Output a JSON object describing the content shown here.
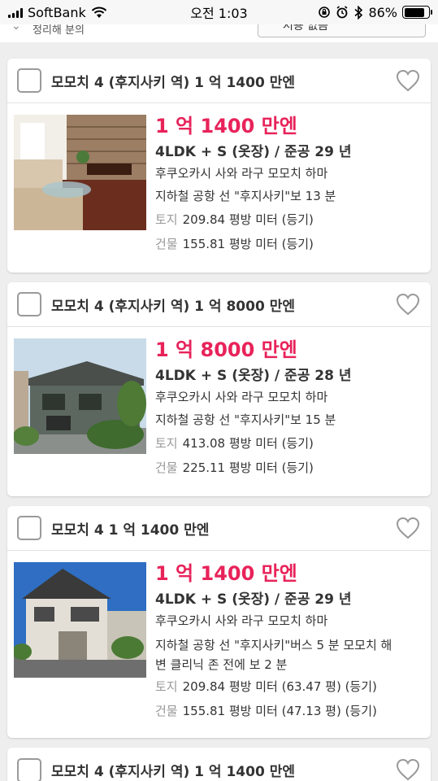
{
  "status_bar": {
    "carrier": "SoftBank",
    "time": "오전 1:03",
    "battery": "86%",
    "battery_level": 0.86
  },
  "top_strip": {
    "sort_hint": "정리해 분의",
    "sort_value": "저용 없음"
  },
  "listings": [
    {
      "title": "모모치 4 (후지사키 역) 1 억 1400 만엔",
      "price": "1 억 1400 만엔",
      "spec": "4LDK + S (옷장)  /  준공 29 년",
      "address": "후쿠오카시 사와 라구 모모치 하마",
      "access": [
        "지하철 공항 선 \"후지사키\"보 13 분"
      ],
      "land_label": "토지",
      "land": "209.84 평방 미터 (등기)",
      "building_label": "건물",
      "building": "155.81 평방 미터 (등기)"
    },
    {
      "title": "모모치 4 (후지사키 역) 1 억 8000 만엔",
      "price": "1 억 8000 만엔",
      "spec": "4LDK + S (옷장)  /  준공 28 년",
      "address": "후쿠오카시 사와 라구 모모치 하마",
      "access": [
        "지하철 공항 선 \"후지사키\"보 15 분"
      ],
      "land_label": "토지",
      "land": "413.08 평방 미터 (등기)",
      "building_label": "건물",
      "building": "225.11 평방 미터 (등기)"
    },
    {
      "title": "모모치 4 1 억 1400 만엔",
      "price": "1 억 1400 만엔",
      "spec": "4LDK + S (옷장)  /  준공 29 년",
      "address": "후쿠오카시 사와 라구 모모치 하마",
      "access": [
        "지하철 공항 선 \"후지사키\"버스 5 분 모모치 해",
        "변 클리닉 존 전에 보 2 분"
      ],
      "land_label": "토지",
      "land": "209.84 평방 미터 (63.47 평) (등기)",
      "building_label": "건물",
      "building": "155.81 평방 미터 (47.13 평) (등기)"
    },
    {
      "title": "모모치 4 (후지사키 역) 1 억 1400 만엔"
    }
  ],
  "colors": {
    "price": "#e8235a",
    "background": "#eeeeee",
    "card": "#ffffff"
  },
  "icons": {
    "favorite": "heart-outline-icon",
    "select": "checkbox-icon"
  }
}
